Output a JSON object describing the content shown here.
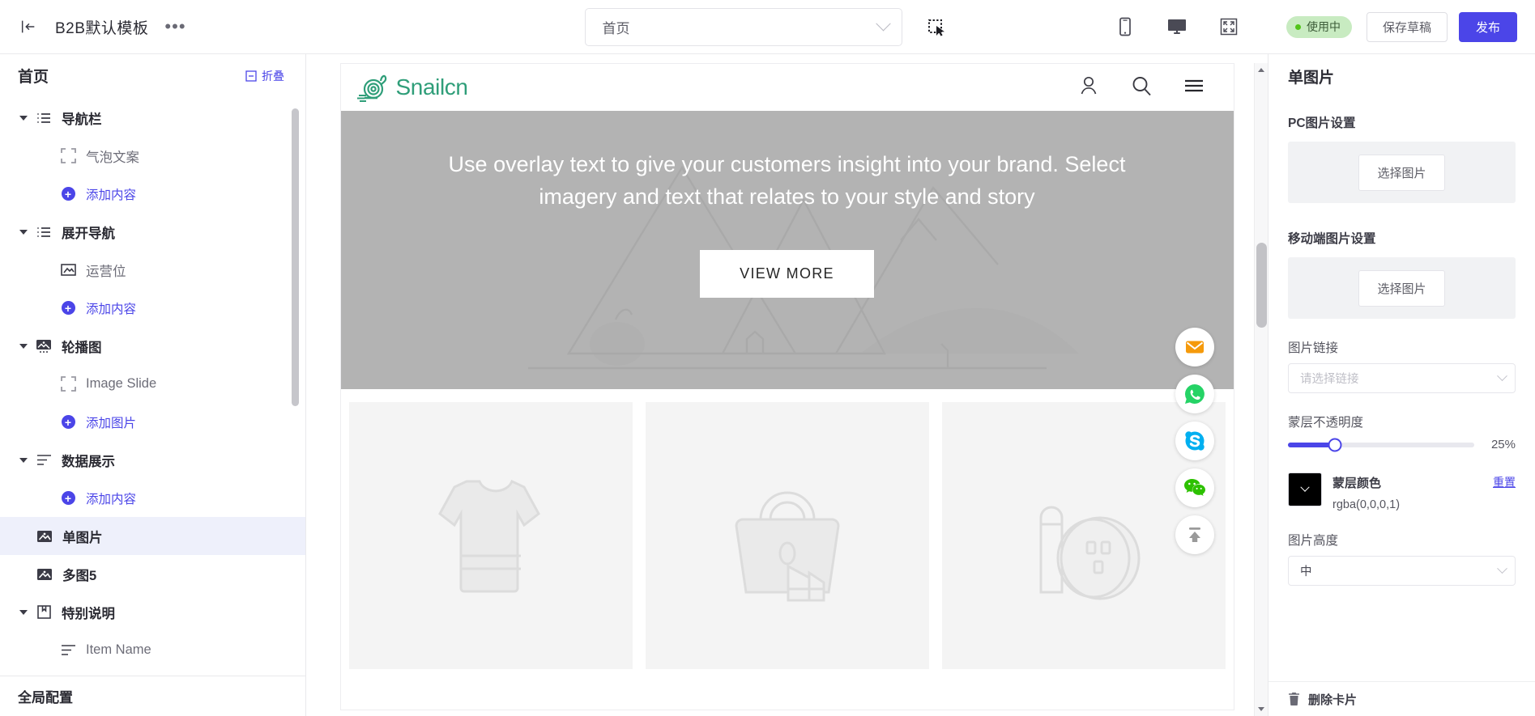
{
  "topbar": {
    "back_icon": "back-arrow-icon",
    "template_title": "B2B默认模板",
    "more_label": "•••",
    "page_selector": {
      "value": "首页",
      "icon": "chevron-down-icon"
    },
    "select_tool_icon": "marquee-select-icon",
    "devices": [
      {
        "name": "mobile-preview",
        "icon": "mobile-icon"
      },
      {
        "name": "desktop-preview",
        "icon": "desktop-icon"
      },
      {
        "name": "fullscreen-preview",
        "icon": "fullscreen-icon"
      }
    ],
    "status_badge": "使用中",
    "status_color": "#52c41a",
    "save_draft_label": "保存草稿",
    "publish_label": "发布",
    "publish_color": "#4b45e8"
  },
  "sidebar": {
    "title": "首页",
    "collapse_label": "折叠",
    "footer_label": "全局配置",
    "accent": "#4b45e8",
    "tree": [
      {
        "label": "导航栏",
        "type": "group",
        "icon": "list-icon",
        "expanded": true
      },
      {
        "label": "气泡文案",
        "type": "child",
        "icon": "frame-icon"
      },
      {
        "label": "添加内容",
        "type": "add",
        "icon": "plus-circle-icon"
      },
      {
        "label": "展开导航",
        "type": "group",
        "icon": "list-icon",
        "expanded": true
      },
      {
        "label": "运营位",
        "type": "child",
        "icon": "banner-icon"
      },
      {
        "label": "添加内容",
        "type": "add",
        "icon": "plus-circle-icon"
      },
      {
        "label": "轮播图",
        "type": "group",
        "icon": "carousel-icon",
        "expanded": true
      },
      {
        "label": "Image Slide",
        "type": "child",
        "icon": "frame-icon"
      },
      {
        "label": "添加图片",
        "type": "add",
        "icon": "plus-circle-icon"
      },
      {
        "label": "数据展示",
        "type": "group",
        "icon": "text-lines-icon",
        "expanded": true
      },
      {
        "label": "添加内容",
        "type": "add",
        "icon": "plus-circle-icon"
      },
      {
        "label": "单图片",
        "type": "leaf-top",
        "icon": "image-icon",
        "selected": true
      },
      {
        "label": "多图5",
        "type": "leaf-top",
        "icon": "image-icon"
      },
      {
        "label": "特别说明",
        "type": "group",
        "icon": "note-icon",
        "expanded": true
      },
      {
        "label": "Item Name",
        "type": "child",
        "icon": "text-lines-icon"
      }
    ]
  },
  "canvas": {
    "site": {
      "logo_text": "Snailcn",
      "logo_color": "#2f9e79",
      "header_icons": [
        {
          "name": "account-icon"
        },
        {
          "name": "search-icon"
        },
        {
          "name": "menu-hamburger-icon"
        }
      ],
      "hero": {
        "text": "Use overlay text to give your customers insight into your brand. Select imagery and text that relates to your style and story",
        "button_label": "VIEW MORE",
        "overlay_color": "#b3b3b3"
      },
      "cards": [
        {
          "name": "product-card-tshirt",
          "icon": "tshirt-placeholder-icon"
        },
        {
          "name": "product-card-bag",
          "icon": "bag-placeholder-icon"
        },
        {
          "name": "product-card-cosmetics",
          "icon": "cosmetics-placeholder-icon"
        }
      ],
      "social_rail": [
        {
          "name": "email-float-button",
          "icon": "email-icon",
          "color": "#f59a0b"
        },
        {
          "name": "whatsapp-float-button",
          "icon": "whatsapp-icon",
          "color": "#25d366"
        },
        {
          "name": "skype-float-button",
          "icon": "skype-icon",
          "color": "#00aff0"
        },
        {
          "name": "wechat-float-button",
          "icon": "wechat-icon",
          "color": "#2dc100"
        },
        {
          "name": "back-to-top-button",
          "icon": "arrow-up-icon",
          "color": "#9a9a9a"
        }
      ]
    }
  },
  "inspector": {
    "title": "单图片",
    "pc_image_label": "PC图片设置",
    "pc_pick_label": "选择图片",
    "mobile_image_label": "移动端图片设置",
    "mobile_pick_label": "选择图片",
    "link_label": "图片链接",
    "link_placeholder": "请选择链接",
    "opacity_label": "蒙层不透明度",
    "opacity_value": "25%",
    "mask_color_label": "蒙层颜色",
    "mask_color_value": "rgba(0,0,0,1)",
    "mask_color_hex": "#000000",
    "reset_label": "重置",
    "height_label": "图片高度",
    "height_value": "中",
    "delete_label": "删除卡片",
    "delete_icon": "trash-icon"
  }
}
